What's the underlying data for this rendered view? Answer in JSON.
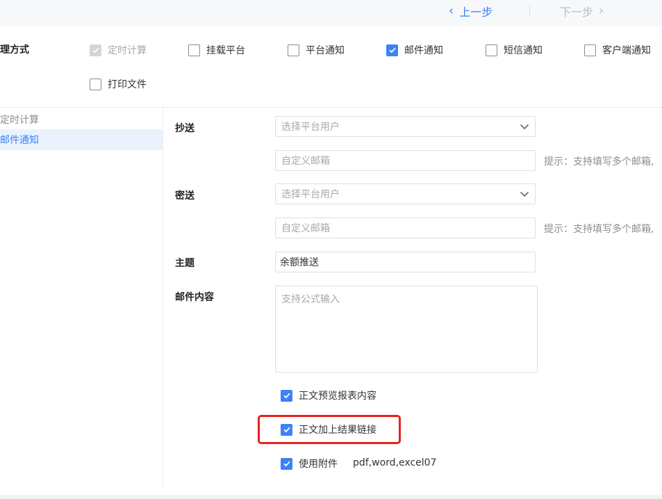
{
  "nav": {
    "prev_label": "上一步",
    "next_label": "下一步",
    "prev_icon": "chevron-left-icon",
    "next_icon": "chevron-right-icon"
  },
  "method": {
    "label": "理方式",
    "options": [
      {
        "label": "定时计算",
        "checked": true,
        "disabled": true
      },
      {
        "label": "挂载平台",
        "checked": false
      },
      {
        "label": "平台通知",
        "checked": false
      },
      {
        "label": "邮件通知",
        "checked": true
      },
      {
        "label": "短信通知",
        "checked": false
      },
      {
        "label": "客户端通知",
        "checked": false
      },
      {
        "label": "打印文件",
        "checked": false
      }
    ]
  },
  "sidebar": {
    "items": [
      {
        "label": "定时计算"
      },
      {
        "label": "邮件通知"
      }
    ]
  },
  "form": {
    "cc": {
      "label": "抄送",
      "select_placeholder": "选择平台用户",
      "email_placeholder": "自定义邮箱",
      "hint": "提示：支持填写多个邮箱,"
    },
    "bcc": {
      "label": "密送",
      "select_placeholder": "选择平台用户",
      "email_placeholder": "自定义邮箱",
      "hint": "提示：支持填写多个邮箱,"
    },
    "subject": {
      "label": "主题",
      "value": "余额推送"
    },
    "content": {
      "label": "邮件内容",
      "placeholder": "支持公式输入"
    },
    "options": [
      {
        "label": "正文预览报表内容",
        "checked": true
      },
      {
        "label": "正文加上结果链接",
        "checked": true
      },
      {
        "label": "使用附件",
        "checked": true
      }
    ],
    "attachment_types": "pdf,word,excel07"
  },
  "colors": {
    "accent": "#3b82f6",
    "highlight": "#e8201f"
  }
}
